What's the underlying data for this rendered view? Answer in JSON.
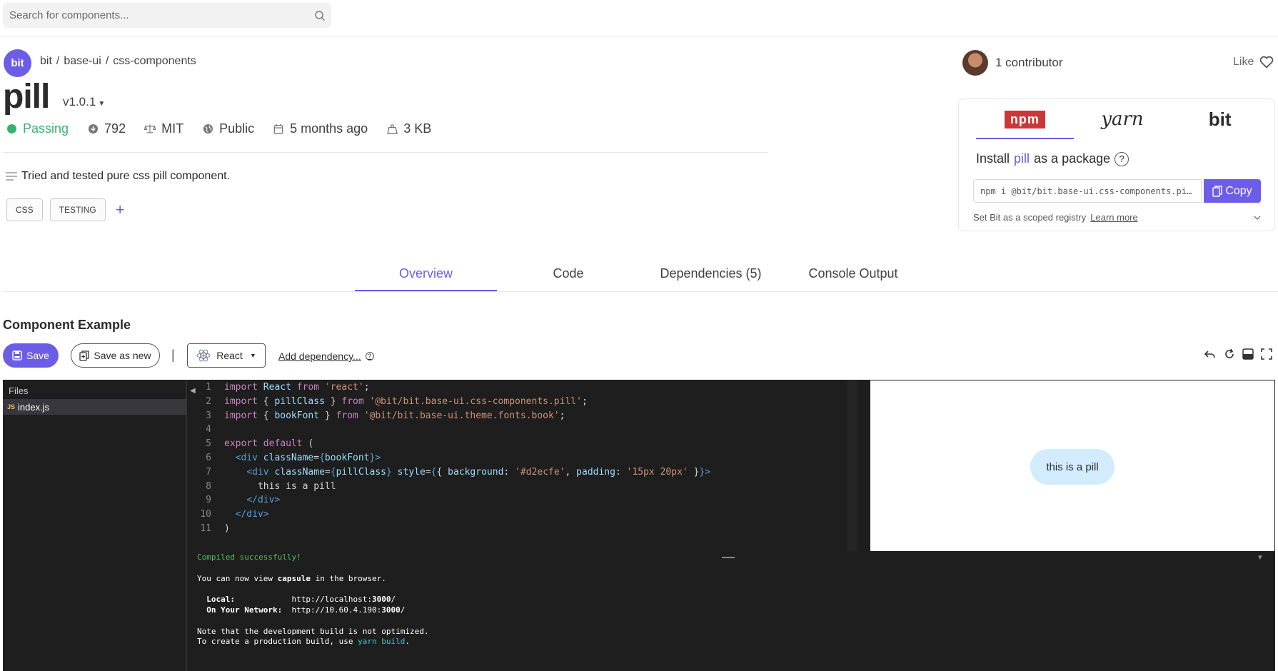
{
  "search": {
    "placeholder": "Search for components..."
  },
  "owner": {
    "avatar_text": "bit"
  },
  "breadcrumb": [
    "bit",
    "/",
    "base-ui",
    "/",
    "css-components"
  ],
  "component": {
    "name": "pill",
    "version": "v1.0.1"
  },
  "stats": {
    "status": "Passing",
    "downloads": "792",
    "license": "MIT",
    "visibility": "Public",
    "updated": "5 months ago",
    "size": "3 KB"
  },
  "description": "Tried and tested pure css pill component.",
  "tags": [
    "CSS",
    "TESTING"
  ],
  "add_tag": "+",
  "contributors": {
    "text": "1 contributor"
  },
  "like": {
    "label": "Like"
  },
  "install": {
    "tabs": [
      "npm",
      "yarn",
      "bit"
    ],
    "active_tab": "npm",
    "title_prefix": "Install",
    "title_accent": "pill",
    "title_suffix": "as a package",
    "help": "?",
    "command": "npm i @bit/bit.base-ui.css-components.pi…",
    "copy_label": "Copy",
    "registry_text": "Set Bit as a scoped registry",
    "learn_more": "Learn more"
  },
  "main_tabs": [
    "Overview",
    "Code",
    "Dependencies (5)",
    "Console Output"
  ],
  "example": {
    "title": "Component Example",
    "save": "Save",
    "save_as_new": "Save as new",
    "separator": "|",
    "framework": "React",
    "add_dependency": "Add dependency...",
    "add_dependency_help": "?"
  },
  "files": {
    "label": "Files",
    "items": [
      {
        "badge": "JS",
        "name": "index.js"
      }
    ]
  },
  "code_lines": [
    "import React from 'react';",
    "import { pillClass } from '@bit/bit.base-ui.css-components.pill';",
    "import { bookFont } from '@bit/bit.base-ui.theme.fonts.book';",
    "",
    "export default (",
    "  <div className={bookFont}>",
    "    <div className={pillClass} style={{ background: '#d2ecfe', padding: '15px 20px' }}>",
    "      this is a pill",
    "    </div>",
    "  </div>",
    ")"
  ],
  "preview": {
    "pill_text": "this is a pill",
    "pill_color": "#d2ecfe"
  },
  "console": {
    "compiled": "Compiled successfully!",
    "view_prefix": "You can now view ",
    "view_app": "capsule",
    "view_suffix": " in the browser.",
    "local_label": "  Local:            ",
    "local_url_base": "http://localhost:",
    "local_port": "3000",
    "network_label": "  On Your Network:  ",
    "network_url_base": "http://10.60.4.190:",
    "network_port": "3000",
    "note": "Note that the development build is not optimized.",
    "prod_prefix": "To create a production build, use ",
    "prod_cmd": "yarn build",
    "prod_suffix": "."
  },
  "colors": {
    "accent": "#6c5ce7",
    "passing": "#37b26c",
    "npm": "#cb3837"
  }
}
